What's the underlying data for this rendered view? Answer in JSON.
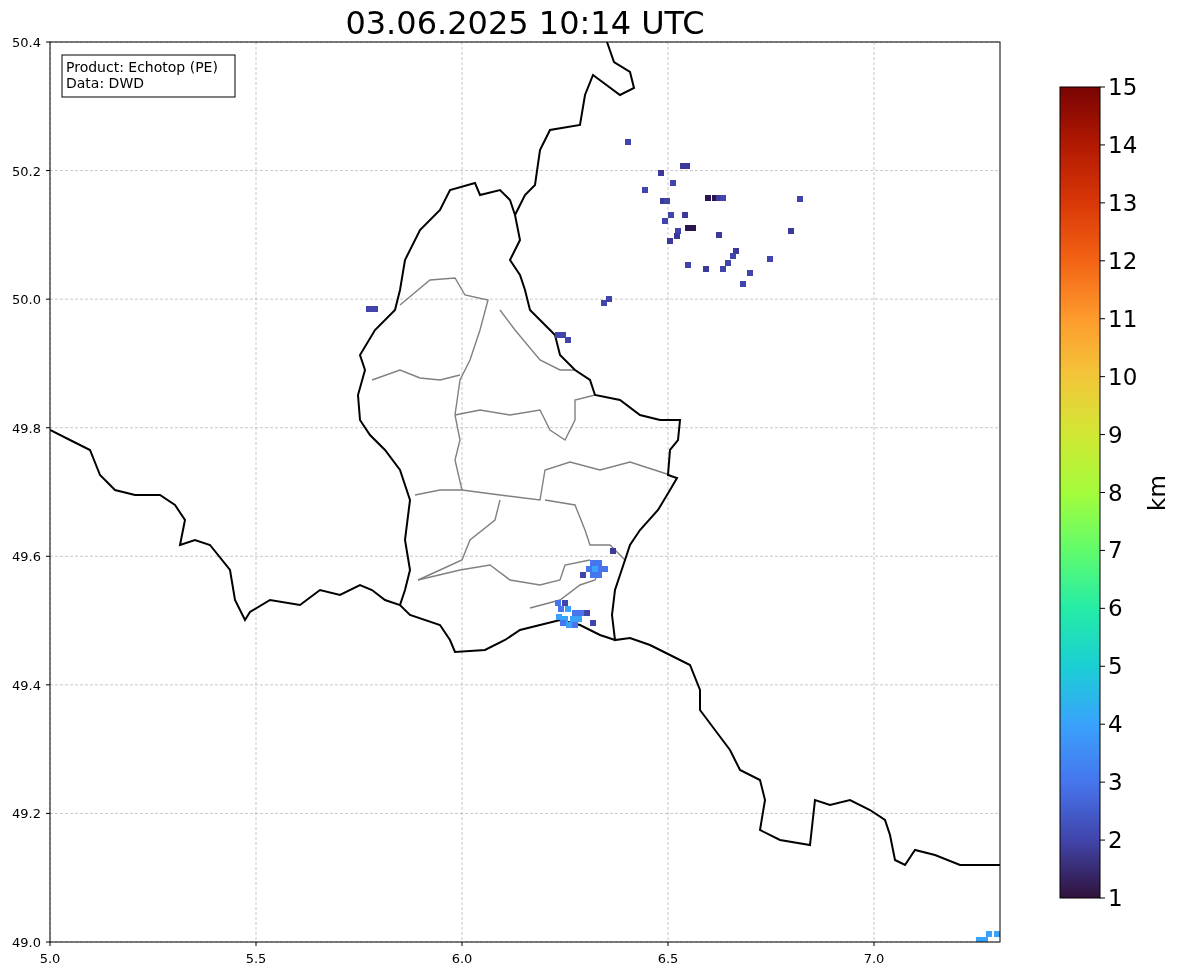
{
  "title": "03.06.2025 10:14 UTC",
  "map": {
    "legend": [
      "Product: Echotop (PE)",
      "Data: DWD"
    ],
    "x_ticks": [
      "5.0",
      "5.5",
      "6.0",
      "6.5",
      "7.0"
    ],
    "y_ticks": [
      "50.4",
      "50.2",
      "50.0",
      "49.8",
      "49.6",
      "49.4",
      "49.2",
      "49.0"
    ]
  },
  "colorbar": {
    "label": "km",
    "ticks": [
      "15",
      "14",
      "13",
      "12",
      "11",
      "10",
      "9",
      "8",
      "7",
      "6",
      "5",
      "4",
      "3",
      "2",
      "1"
    ]
  }
}
